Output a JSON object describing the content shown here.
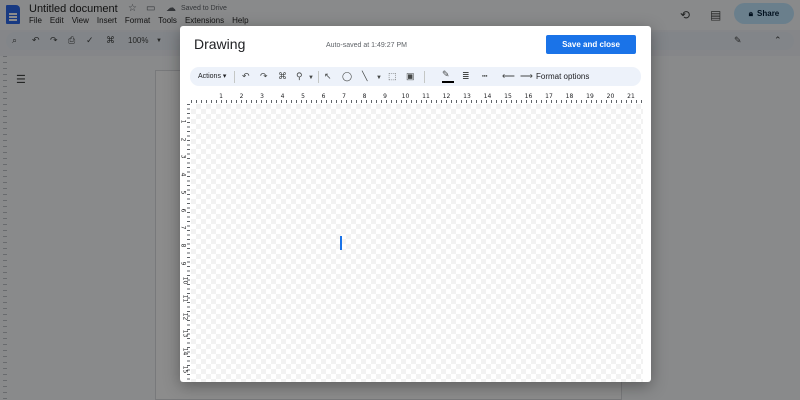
{
  "docs": {
    "title": "Untitled document",
    "saved_status": "Saved to Drive",
    "menu": [
      "File",
      "Edit",
      "View",
      "Insert",
      "Format",
      "Tools",
      "Extensions",
      "Help"
    ],
    "zoom": "100%",
    "share_label": "Share",
    "share_icon": "lock-icon"
  },
  "dialog": {
    "title": "Drawing",
    "autosave": "Auto-saved at 1:49:27 PM",
    "save_close_label": "Save and close",
    "accent_color": "#1a73e8",
    "toolbar": {
      "actions_label": "Actions",
      "format_options_label": "Format options",
      "icons": [
        "undo-icon",
        "redo-icon",
        "paint-format-icon",
        "zoom-icon",
        "select-icon",
        "shape-icon",
        "line-icon",
        "text-box-icon",
        "image-icon",
        "pen-icon",
        "line-weight-icon",
        "line-dash-icon",
        "line-start-icon",
        "line-end-icon"
      ]
    },
    "ruler": {
      "horizontal": [
        "1",
        "2",
        "3",
        "4",
        "5",
        "6",
        "7",
        "8",
        "9",
        "10",
        "11",
        "12",
        "13",
        "14",
        "15",
        "16",
        "17",
        "18",
        "19",
        "20",
        "21"
      ],
      "vertical": [
        "1",
        "2",
        "3",
        "4",
        "5",
        "6",
        "7",
        "8",
        "9",
        "10",
        "11",
        "12",
        "13",
        "14",
        "15"
      ]
    }
  }
}
